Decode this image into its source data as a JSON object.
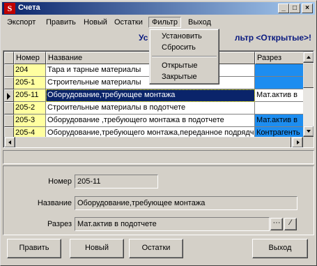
{
  "window": {
    "title": "Счета"
  },
  "menubar": {
    "items": [
      "Экспорт",
      "Править",
      "Новый",
      "Остатки",
      "Фильтр",
      "Выход"
    ]
  },
  "filter_menu": {
    "items": [
      "Установить",
      "Сбросить",
      "Открытые",
      "Закрытые"
    ]
  },
  "heading": {
    "left": "Ус",
    "right": "льтр <Открытые>!"
  },
  "grid": {
    "columns": [
      "Номер",
      "Название",
      "Разрез"
    ],
    "rows": [
      {
        "num": "204",
        "name": "Тара и тарные материалы",
        "razrez": ""
      },
      {
        "num": "205-1",
        "name": "Строительные материалы",
        "razrez": ""
      },
      {
        "num": "205-11",
        "name": "Оборудование,требующее монтажа",
        "razrez": "Мат.актив в"
      },
      {
        "num": "205-2",
        "name": "Строительные материалы в подотчете",
        "razrez": ""
      },
      {
        "num": "205-3",
        "name": "Оборудование ,требующего монтажа в подотчете",
        "razrez": "Мат.актив в"
      },
      {
        "num": "205-4",
        "name": "Оборудование,требующего монтажа,переданное подрядчи",
        "razrez": "Контрагенть"
      }
    ]
  },
  "detail": {
    "num_label": "Номер",
    "num_value": "205-11",
    "name_label": "Название",
    "name_value": "Оборудование,требующее монтажа",
    "razrez_label": "Разрез",
    "razrez_value": "Мат.актив в подотчете",
    "ellipsis_btn": "···",
    "clear_btn": "⁄"
  },
  "buttons": {
    "edit": "Править",
    "new": "Новый",
    "balances": "Остатки",
    "exit": "Выход"
  },
  "titlebar_buttons": {
    "minimize": "_",
    "maximize": "□",
    "close": "×"
  }
}
